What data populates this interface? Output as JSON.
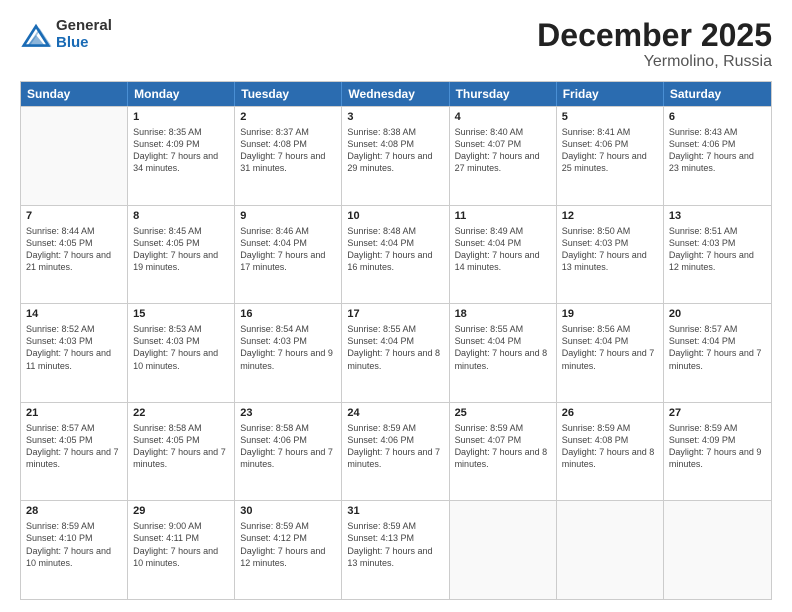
{
  "logo": {
    "general": "General",
    "blue": "Blue"
  },
  "title": {
    "month": "December 2025",
    "location": "Yermolino, Russia"
  },
  "header_days": [
    "Sunday",
    "Monday",
    "Tuesday",
    "Wednesday",
    "Thursday",
    "Friday",
    "Saturday"
  ],
  "weeks": [
    [
      {
        "date": "",
        "sunrise": "",
        "sunset": "",
        "daylight": "",
        "empty": true
      },
      {
        "date": "1",
        "sunrise": "Sunrise: 8:35 AM",
        "sunset": "Sunset: 4:09 PM",
        "daylight": "Daylight: 7 hours and 34 minutes."
      },
      {
        "date": "2",
        "sunrise": "Sunrise: 8:37 AM",
        "sunset": "Sunset: 4:08 PM",
        "daylight": "Daylight: 7 hours and 31 minutes."
      },
      {
        "date": "3",
        "sunrise": "Sunrise: 8:38 AM",
        "sunset": "Sunset: 4:08 PM",
        "daylight": "Daylight: 7 hours and 29 minutes."
      },
      {
        "date": "4",
        "sunrise": "Sunrise: 8:40 AM",
        "sunset": "Sunset: 4:07 PM",
        "daylight": "Daylight: 7 hours and 27 minutes."
      },
      {
        "date": "5",
        "sunrise": "Sunrise: 8:41 AM",
        "sunset": "Sunset: 4:06 PM",
        "daylight": "Daylight: 7 hours and 25 minutes."
      },
      {
        "date": "6",
        "sunrise": "Sunrise: 8:43 AM",
        "sunset": "Sunset: 4:06 PM",
        "daylight": "Daylight: 7 hours and 23 minutes."
      }
    ],
    [
      {
        "date": "7",
        "sunrise": "Sunrise: 8:44 AM",
        "sunset": "Sunset: 4:05 PM",
        "daylight": "Daylight: 7 hours and 21 minutes."
      },
      {
        "date": "8",
        "sunrise": "Sunrise: 8:45 AM",
        "sunset": "Sunset: 4:05 PM",
        "daylight": "Daylight: 7 hours and 19 minutes."
      },
      {
        "date": "9",
        "sunrise": "Sunrise: 8:46 AM",
        "sunset": "Sunset: 4:04 PM",
        "daylight": "Daylight: 7 hours and 17 minutes."
      },
      {
        "date": "10",
        "sunrise": "Sunrise: 8:48 AM",
        "sunset": "Sunset: 4:04 PM",
        "daylight": "Daylight: 7 hours and 16 minutes."
      },
      {
        "date": "11",
        "sunrise": "Sunrise: 8:49 AM",
        "sunset": "Sunset: 4:04 PM",
        "daylight": "Daylight: 7 hours and 14 minutes."
      },
      {
        "date": "12",
        "sunrise": "Sunrise: 8:50 AM",
        "sunset": "Sunset: 4:03 PM",
        "daylight": "Daylight: 7 hours and 13 minutes."
      },
      {
        "date": "13",
        "sunrise": "Sunrise: 8:51 AM",
        "sunset": "Sunset: 4:03 PM",
        "daylight": "Daylight: 7 hours and 12 minutes."
      }
    ],
    [
      {
        "date": "14",
        "sunrise": "Sunrise: 8:52 AM",
        "sunset": "Sunset: 4:03 PM",
        "daylight": "Daylight: 7 hours and 11 minutes."
      },
      {
        "date": "15",
        "sunrise": "Sunrise: 8:53 AM",
        "sunset": "Sunset: 4:03 PM",
        "daylight": "Daylight: 7 hours and 10 minutes."
      },
      {
        "date": "16",
        "sunrise": "Sunrise: 8:54 AM",
        "sunset": "Sunset: 4:03 PM",
        "daylight": "Daylight: 7 hours and 9 minutes."
      },
      {
        "date": "17",
        "sunrise": "Sunrise: 8:55 AM",
        "sunset": "Sunset: 4:04 PM",
        "daylight": "Daylight: 7 hours and 8 minutes."
      },
      {
        "date": "18",
        "sunrise": "Sunrise: 8:55 AM",
        "sunset": "Sunset: 4:04 PM",
        "daylight": "Daylight: 7 hours and 8 minutes."
      },
      {
        "date": "19",
        "sunrise": "Sunrise: 8:56 AM",
        "sunset": "Sunset: 4:04 PM",
        "daylight": "Daylight: 7 hours and 7 minutes."
      },
      {
        "date": "20",
        "sunrise": "Sunrise: 8:57 AM",
        "sunset": "Sunset: 4:04 PM",
        "daylight": "Daylight: 7 hours and 7 minutes."
      }
    ],
    [
      {
        "date": "21",
        "sunrise": "Sunrise: 8:57 AM",
        "sunset": "Sunset: 4:05 PM",
        "daylight": "Daylight: 7 hours and 7 minutes."
      },
      {
        "date": "22",
        "sunrise": "Sunrise: 8:58 AM",
        "sunset": "Sunset: 4:05 PM",
        "daylight": "Daylight: 7 hours and 7 minutes."
      },
      {
        "date": "23",
        "sunrise": "Sunrise: 8:58 AM",
        "sunset": "Sunset: 4:06 PM",
        "daylight": "Daylight: 7 hours and 7 minutes."
      },
      {
        "date": "24",
        "sunrise": "Sunrise: 8:59 AM",
        "sunset": "Sunset: 4:06 PM",
        "daylight": "Daylight: 7 hours and 7 minutes."
      },
      {
        "date": "25",
        "sunrise": "Sunrise: 8:59 AM",
        "sunset": "Sunset: 4:07 PM",
        "daylight": "Daylight: 7 hours and 8 minutes."
      },
      {
        "date": "26",
        "sunrise": "Sunrise: 8:59 AM",
        "sunset": "Sunset: 4:08 PM",
        "daylight": "Daylight: 7 hours and 8 minutes."
      },
      {
        "date": "27",
        "sunrise": "Sunrise: 8:59 AM",
        "sunset": "Sunset: 4:09 PM",
        "daylight": "Daylight: 7 hours and 9 minutes."
      }
    ],
    [
      {
        "date": "28",
        "sunrise": "Sunrise: 8:59 AM",
        "sunset": "Sunset: 4:10 PM",
        "daylight": "Daylight: 7 hours and 10 minutes."
      },
      {
        "date": "29",
        "sunrise": "Sunrise: 9:00 AM",
        "sunset": "Sunset: 4:11 PM",
        "daylight": "Daylight: 7 hours and 10 minutes."
      },
      {
        "date": "30",
        "sunrise": "Sunrise: 8:59 AM",
        "sunset": "Sunset: 4:12 PM",
        "daylight": "Daylight: 7 hours and 12 minutes."
      },
      {
        "date": "31",
        "sunrise": "Sunrise: 8:59 AM",
        "sunset": "Sunset: 4:13 PM",
        "daylight": "Daylight: 7 hours and 13 minutes."
      },
      {
        "date": "",
        "sunrise": "",
        "sunset": "",
        "daylight": "",
        "empty": true
      },
      {
        "date": "",
        "sunrise": "",
        "sunset": "",
        "daylight": "",
        "empty": true
      },
      {
        "date": "",
        "sunrise": "",
        "sunset": "",
        "daylight": "",
        "empty": true
      }
    ]
  ]
}
